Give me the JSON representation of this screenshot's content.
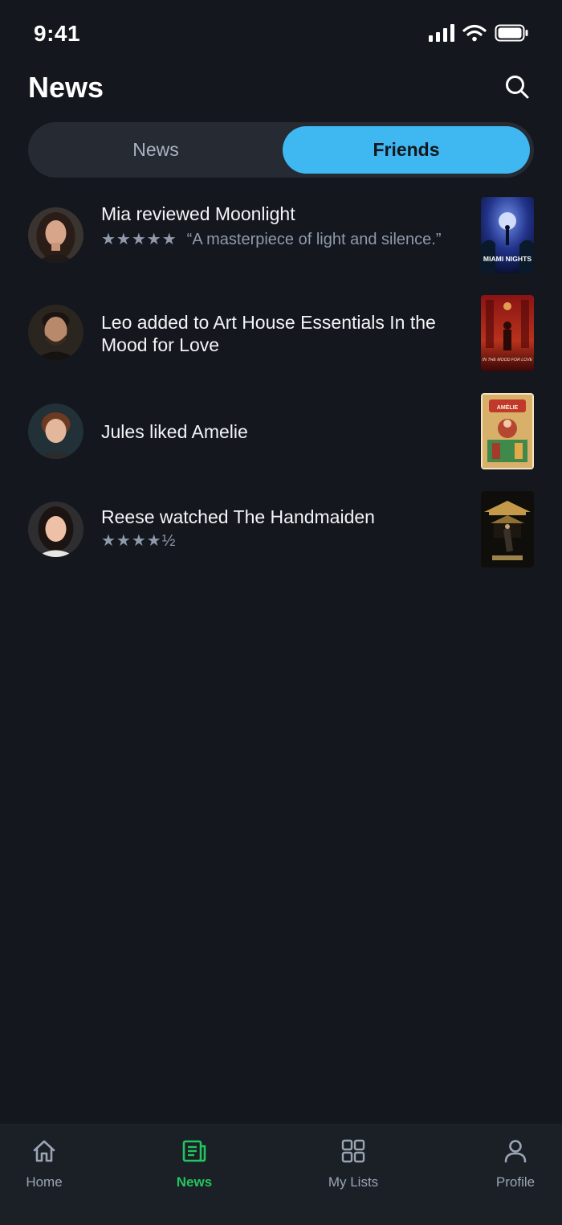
{
  "status_bar": {
    "time": "9:41",
    "icons": [
      "signal-icon",
      "wifi-icon",
      "battery-icon"
    ]
  },
  "header": {
    "title": "News",
    "search_icon": "search-icon"
  },
  "tabs": [
    {
      "label": "News",
      "selected": false
    },
    {
      "label": "Friends",
      "selected": true
    }
  ],
  "feed": [
    {
      "title": "Mia reviewed Moonlight",
      "stars": "★★★★★",
      "review": "“A masterpiece of light and silence.”",
      "poster_text": "MIAMI NIGHTS"
    },
    {
      "title": "Leo added to Art House Essentials In the Mood for Love",
      "poster_text": "IN THE MOOD FOR LOVE"
    },
    {
      "title": "Jules liked Amelie",
      "poster_text": "AMÉLIE"
    },
    {
      "title": "Reese watched The Handmaiden",
      "stars": "★★★★½"
    }
  ],
  "bottom_nav": [
    {
      "label": "Home",
      "icon": "home-icon",
      "active": false
    },
    {
      "label": "News",
      "icon": "news-icon",
      "active": true
    },
    {
      "label": "My Lists",
      "icon": "grid-icon",
      "active": false
    },
    {
      "label": "Profile",
      "icon": "profile-icon",
      "active": false
    }
  ],
  "colors": {
    "background": "#14171d",
    "accent_blue": "#3fb8f2",
    "active_green": "#22c55e",
    "muted_text": "#8f9aab"
  }
}
